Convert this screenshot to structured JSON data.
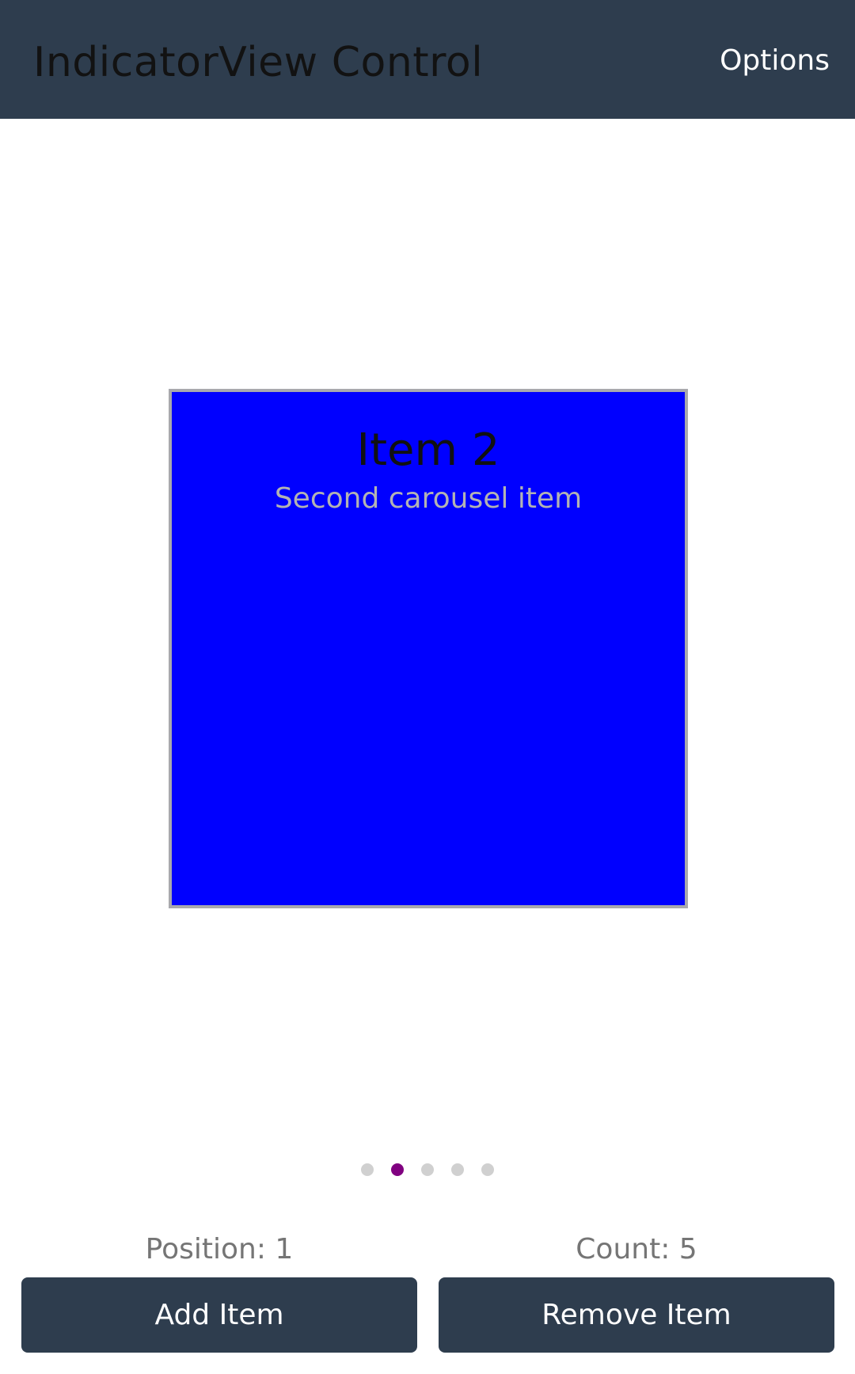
{
  "app_bar": {
    "title": "IndicatorView Control",
    "options_label": "Options",
    "background_color": "#2e3d4e"
  },
  "carousel": {
    "current_item": {
      "title": "Item 2",
      "subtitle": "Second carousel item",
      "color": "#0000ff"
    }
  },
  "indicator": {
    "count": 5,
    "selected_index": 1,
    "selected_color": "#800080",
    "unselected_color": "#d0d0d0"
  },
  "status": {
    "position_label": "Position: 1",
    "count_label": "Count: 5"
  },
  "actions": {
    "add_label": "Add Item",
    "remove_label": "Remove Item"
  }
}
